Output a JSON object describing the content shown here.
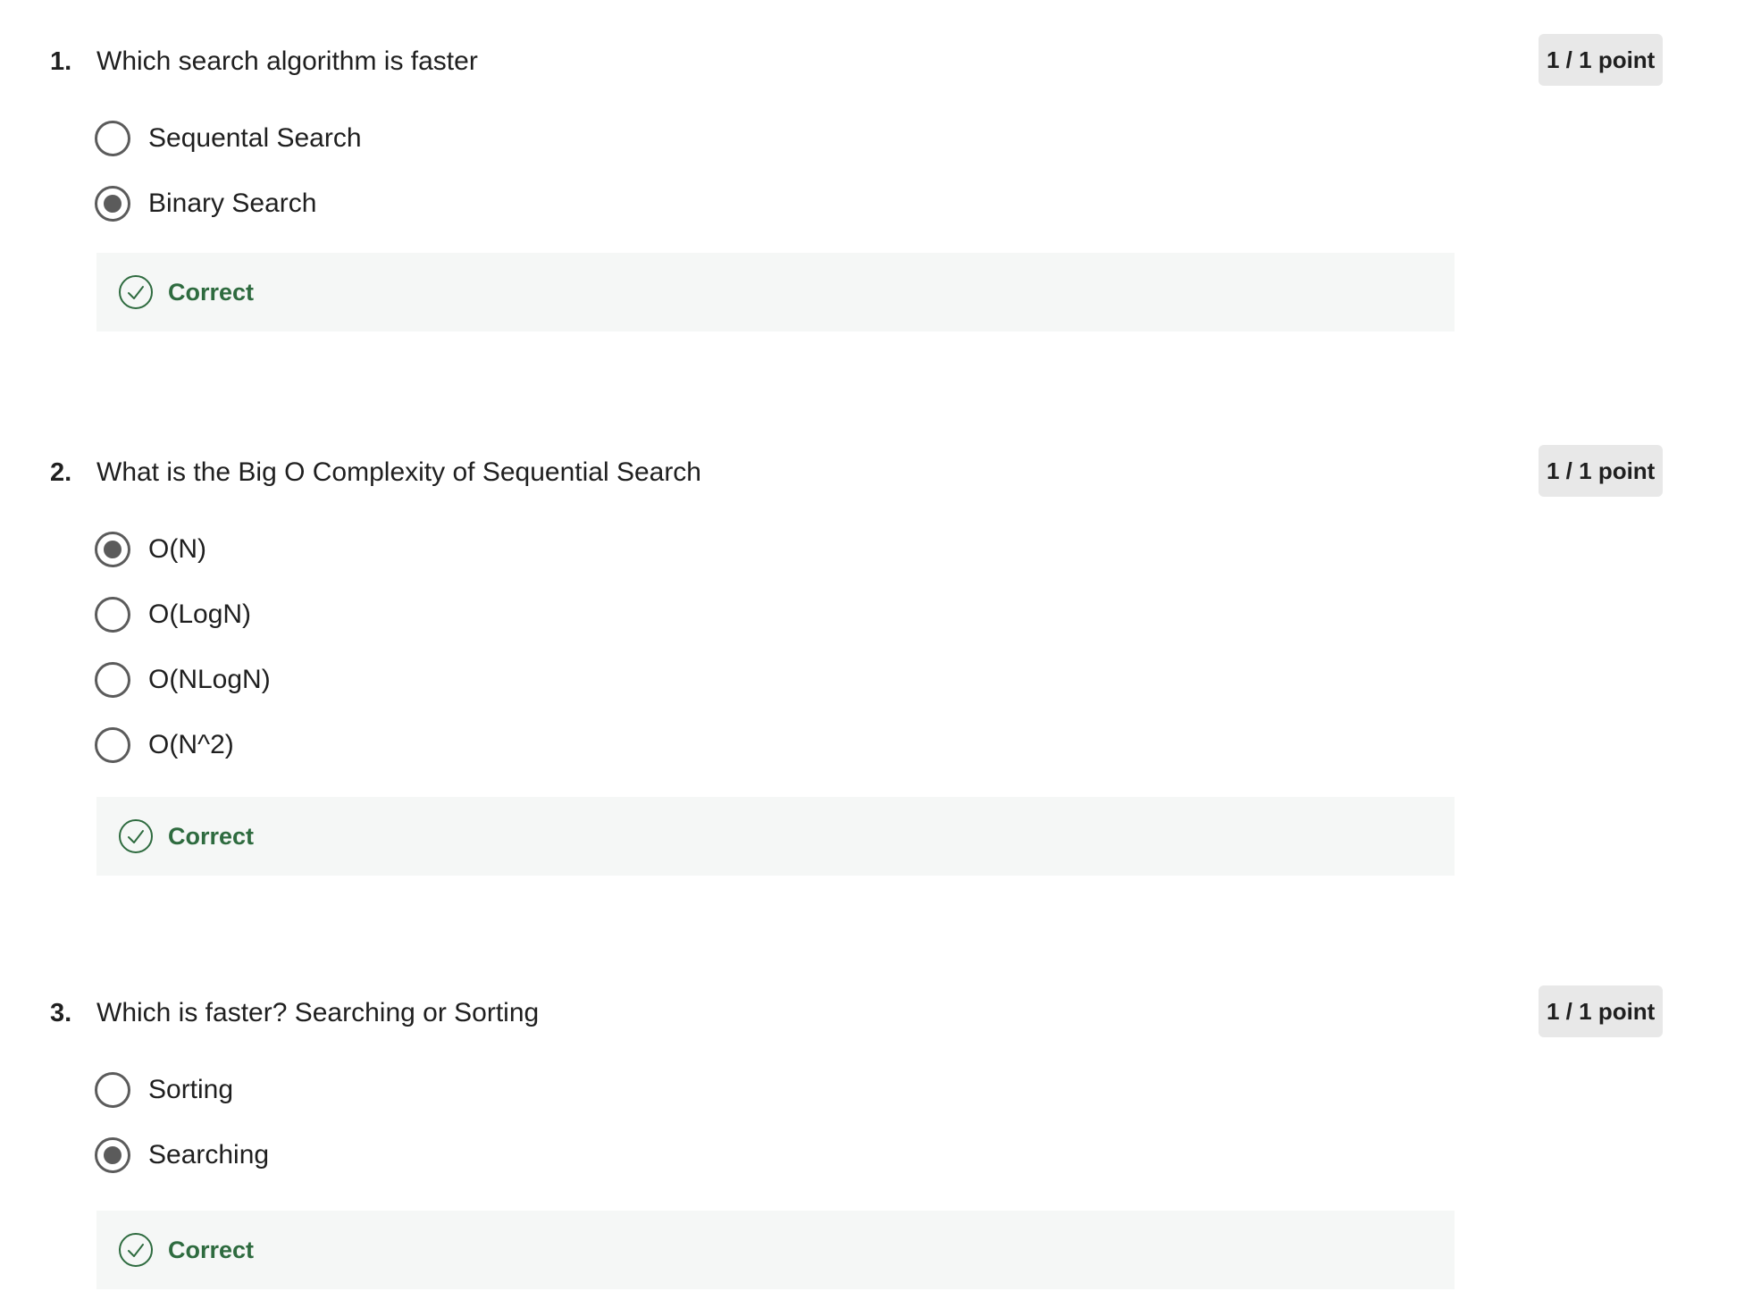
{
  "questions": [
    {
      "number": "1.",
      "text": "Which search algorithm is faster",
      "points": "1 / 1 point",
      "options": [
        {
          "label": "Sequental Search",
          "selected": false
        },
        {
          "label": "Binary Search",
          "selected": true
        }
      ],
      "feedback": "Correct"
    },
    {
      "number": "2.",
      "text": "What is the Big O Complexity of Sequential Search",
      "points": "1 / 1 point",
      "options": [
        {
          "label": "O(N)",
          "selected": true
        },
        {
          "label": "O(LogN)",
          "selected": false
        },
        {
          "label": "O(NLogN)",
          "selected": false
        },
        {
          "label": "O(N^2)",
          "selected": false
        }
      ],
      "feedback": "Correct"
    },
    {
      "number": "3.",
      "text": "Which is faster? Searching or Sorting",
      "points": "1 / 1 point",
      "options": [
        {
          "label": "Sorting",
          "selected": false
        },
        {
          "label": "Searching",
          "selected": true
        }
      ],
      "feedback": "Correct"
    }
  ],
  "icons": {
    "feedback_icon": "check-circle-icon"
  },
  "colors": {
    "correct": "#2e6b3f",
    "feedback_bg": "#f5f7f6",
    "badge_bg": "#e8e8e8",
    "radio": "#5b5b5b"
  }
}
